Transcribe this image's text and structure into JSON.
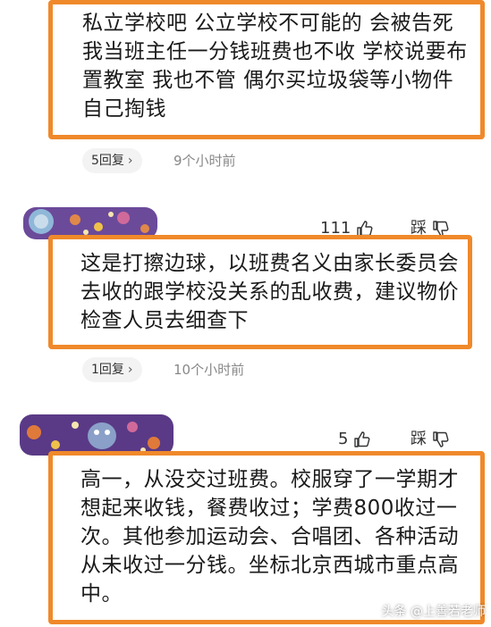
{
  "comments": [
    {
      "text_lines": [
        "私立学校吧 公立学校不可能的 会被告死",
        "我当班主任一分钱班费也不收 学校说要布",
        "置教室 我也不管 偶尔买垃圾袋等小物件",
        "自己掏钱"
      ],
      "reply_label": "5回复",
      "time": "9个小时前"
    },
    {
      "likes": "111",
      "dislike_label": "踩",
      "text_lines": [
        "这是打擦边球，以班费名义由家长委员会",
        "去收的跟学校没关系的乱收费，建议物价",
        "检查人员去细查下"
      ],
      "reply_label": "1回复",
      "time": "10个小时前"
    },
    {
      "likes": "5",
      "dislike_label": "踩",
      "text_lines": [
        "高一，从没交过班费。校服穿了一学期才",
        "想起来收钱，餐费收过；学费800收过一",
        "次。其他参加运动会、合唱团、各种活动",
        "从未收过一分钱。坐标北京西城市重点高",
        "中。"
      ]
    }
  ],
  "watermark": "头条 @上善若老师",
  "colors": {
    "highlight": "#f0892a",
    "text": "#1a1a1a",
    "muted": "#888888",
    "pill_bg": "#f3f3f3"
  },
  "icons": {
    "like": "thumbs-up-icon",
    "dislike": "thumbs-down-icon",
    "chevron": "chevron-right-icon"
  }
}
